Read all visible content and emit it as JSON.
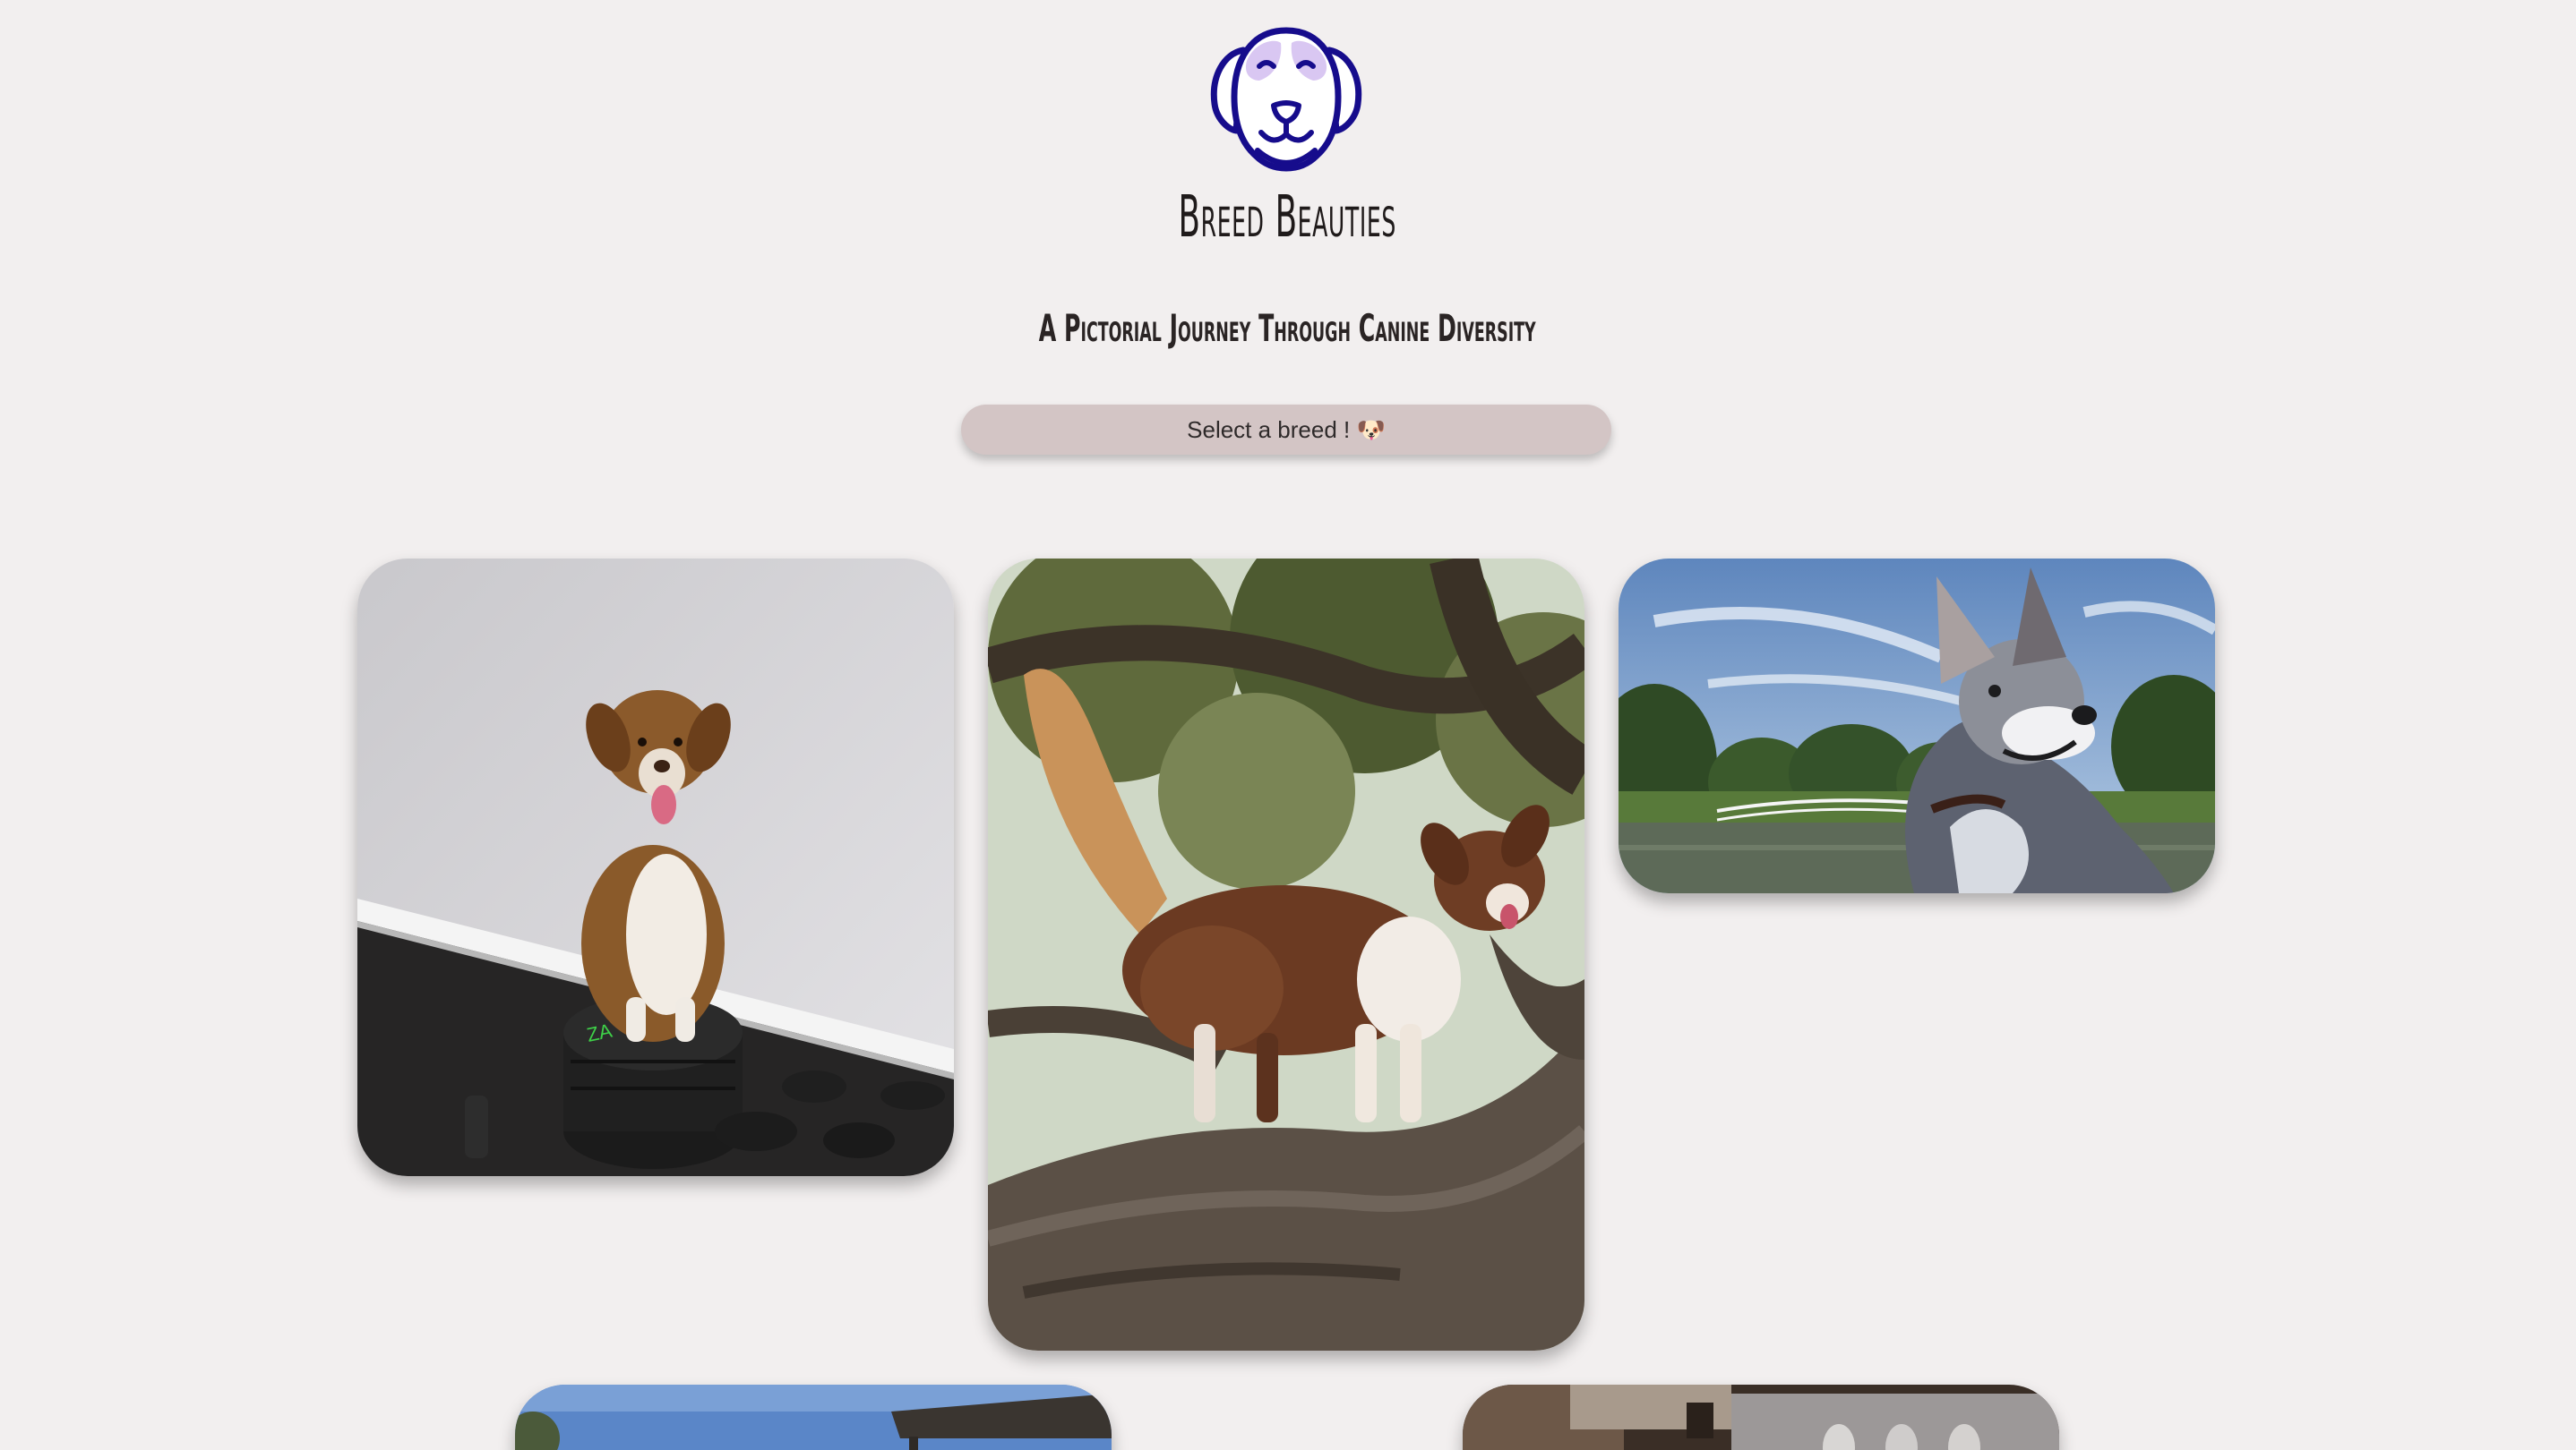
{
  "header": {
    "logo_icon": "dog-face-icon",
    "title": "Breed Beauties",
    "subtitle": "A Pictorial Journey Through Canine Diversity"
  },
  "breed_select": {
    "label": "Select a breed ! 🐶"
  },
  "gallery": {
    "images": [
      {
        "icon": "dog-photo",
        "subject": "dog-on-weight-plates"
      },
      {
        "icon": "dog-photo",
        "subject": "dog-on-tree-branch"
      },
      {
        "icon": "dog-photo",
        "subject": "dog-by-lake"
      },
      {
        "icon": "dog-photo",
        "subject": "outdoor-patio"
      },
      {
        "icon": "dog-photo",
        "subject": "kitchen"
      }
    ]
  },
  "colors": {
    "background": "#f2efef",
    "select_bg": "#d3c5c5",
    "logo_stroke": "#160c8c",
    "logo_accent": "#d9c7f2"
  }
}
